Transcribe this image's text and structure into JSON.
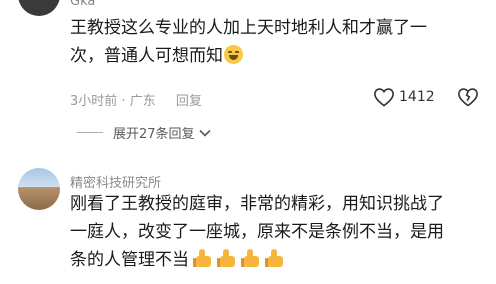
{
  "comments": [
    {
      "username": "Gka",
      "text_line1": "王教授这么专业的人加上天时地利人和才赢了一",
      "text_line2": "次，普通人可想而知",
      "emoji": "grinning-sweat-emoji",
      "meta": {
        "time": "3小时前",
        "location": "广东",
        "reply": "回复"
      },
      "likes": "1412",
      "expand_replies": "展开27条回复"
    },
    {
      "username": "精密科技研究所",
      "text_line1": "刚看了王教授的庭审，非常的精彩，用知识挑战了",
      "text_line2": "一庭人，改变了一座城，原来不是条例不当，是用",
      "text_line3": "条的人管理不当",
      "emoji": "thumbs-up-emoji"
    }
  ],
  "colors": {
    "text": "#1a1a1a",
    "meta": "#9a9a9a",
    "username": "#8a8a8a"
  }
}
